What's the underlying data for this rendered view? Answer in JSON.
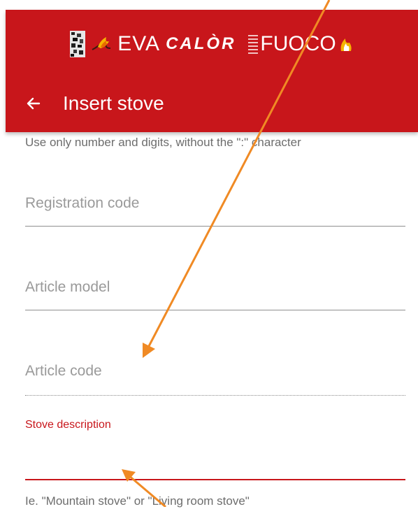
{
  "header": {
    "brand": {
      "eva": "EVA",
      "calor": "CALÒR",
      "fuoco": "FUOCO"
    },
    "title": "Insert stove",
    "back_icon": "arrow-left-icon",
    "color": "#c8161b"
  },
  "form": {
    "top_helper": "Use only number and digits, without the \":\" character",
    "registration_code": {
      "placeholder": "Registration code",
      "value": ""
    },
    "article_model": {
      "placeholder": "Article model",
      "value": ""
    },
    "article_code": {
      "placeholder": "Article code",
      "value": "",
      "disabled": true
    },
    "stove_description": {
      "label": "Stove description",
      "value": "",
      "focused": true
    },
    "bottom_helper": "Ie. \"Mountain stove\" or \"Living room stove\""
  },
  "annotations": {
    "arrow_color": "#f08a24",
    "arrows": [
      "annotation-arrow-to-article-code",
      "annotation-arrow-to-stove-description"
    ]
  }
}
